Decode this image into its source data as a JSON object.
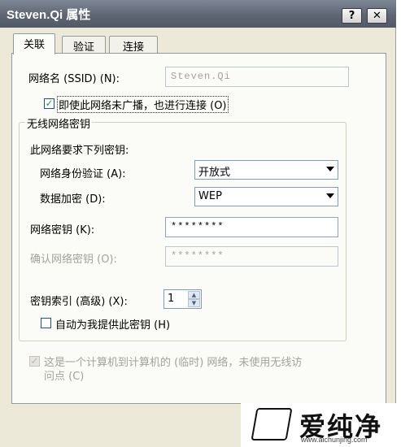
{
  "window": {
    "title": "Steven.Qi 属性",
    "help_glyph": "?",
    "close_glyph": "✕"
  },
  "tabs": [
    {
      "label": "关联",
      "active": true
    },
    {
      "label": "验证",
      "active": false
    },
    {
      "label": "连接",
      "active": false
    }
  ],
  "ssid": {
    "label": "网络名 (SSID) (N):",
    "value": "Steven.Qi"
  },
  "broadcast_checkbox": {
    "checked": true,
    "label": "即使此网络未广播，也进行连接 (O)"
  },
  "key_group": {
    "title": "无线网络密钥",
    "intro": "此网络要求下列密钥:",
    "auth": {
      "label": "网络身份验证 (A):",
      "value": "开放式"
    },
    "encryption": {
      "label": "数据加密 (D):",
      "value": "WEP"
    },
    "network_key": {
      "label": "网络密钥 (K):",
      "value": "********"
    },
    "confirm_key": {
      "label": "确认网络密钥 (O):",
      "value": "********"
    },
    "key_index": {
      "label": "密钥索引 (高级) (X):",
      "value": "1"
    },
    "auto_key": {
      "checked": false,
      "label": "自动为我提供此密钥 (H)"
    }
  },
  "adhoc_checkbox": {
    "checked": true,
    "label_line1": "这是一个计算机到计算机的 (临时) 网络，未使用无线访",
    "label_line2": "问点 (C)"
  },
  "watermark": {
    "text": "爱纯净",
    "url": "www.aichunjing.com"
  }
}
